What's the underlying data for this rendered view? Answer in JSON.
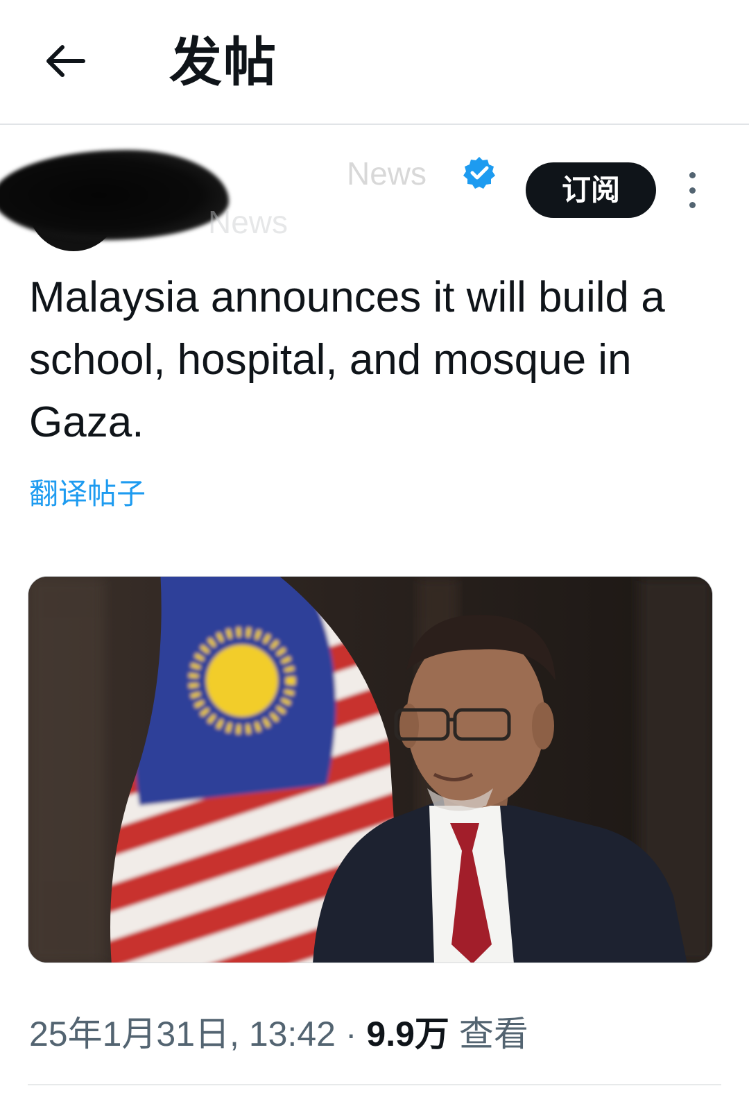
{
  "header": {
    "title": "发帖",
    "back_icon": "arrow-left-icon"
  },
  "author": {
    "display_name": "News",
    "handle": "News",
    "verified": true,
    "verified_color": "#1d9bf0",
    "subscribe_label": "订阅",
    "more_icon": "more-vertical-icon"
  },
  "post": {
    "text": "Malaysia announces it will build a school, hospital, and mosque in Gaza.",
    "translate_label": "翻译帖子",
    "media_icon": "photo-icon"
  },
  "meta": {
    "date": "25年1月31日, 13:42",
    "separator": "·",
    "views_count": "9.9万",
    "views_label": "查看"
  },
  "colors": {
    "accent": "#1d9bf0",
    "text": "#0f1419",
    "secondary": "#536471"
  }
}
